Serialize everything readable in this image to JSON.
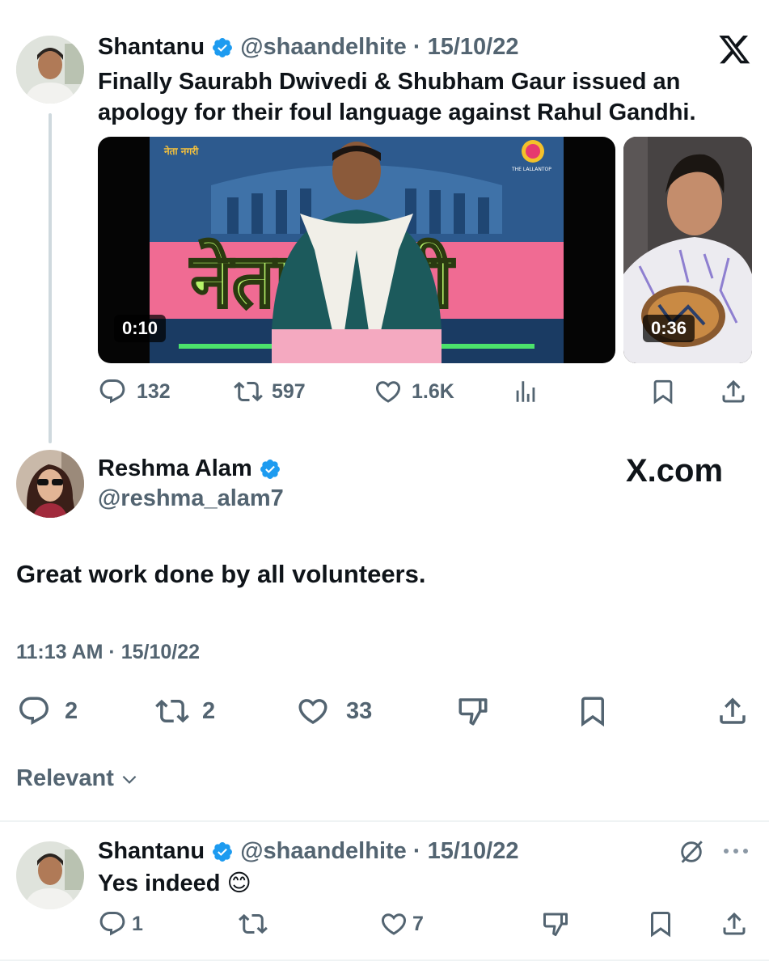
{
  "quoted_tweet": {
    "author_name": "Shantanu",
    "author_handle": "@shaandelhite",
    "separator": "·",
    "date": "15/10/22",
    "text_line1": "Finally Saurabh Dwivedi & Shubham Gaur issued an",
    "text_line2": "apology for their foul language against Rahul Gandhi.",
    "media": [
      {
        "duration": "0:10",
        "overlay_text": "नेता नगरी",
        "logo_text": "नेता नगरी",
        "channel_text": "THE LALLANTOP"
      },
      {
        "duration": "0:36"
      }
    ],
    "stats": {
      "replies": "132",
      "reposts": "597",
      "likes": "1.6K"
    }
  },
  "main_tweet": {
    "author_name": "Reshma Alam",
    "author_handle": "@reshma_alam7",
    "watermark": "X.com",
    "text": "Great work done by all volunteers.",
    "time": "11:13 AM",
    "separator": "·",
    "date": "15/10/22",
    "stats": {
      "replies": "2",
      "reposts": "2",
      "likes": "33"
    }
  },
  "sort": {
    "label": "Relevant"
  },
  "reply": {
    "author_name": "Shantanu",
    "author_handle": "@shaandelhite",
    "separator": "·",
    "date": "15/10/22",
    "text": "Yes indeed",
    "emoji": "😊",
    "stats": {
      "replies": "1",
      "likes": "7"
    }
  },
  "colors": {
    "verified": "#1d9bf0",
    "text": "#0f1419",
    "muted": "#536471",
    "divider": "#eff3f4"
  }
}
